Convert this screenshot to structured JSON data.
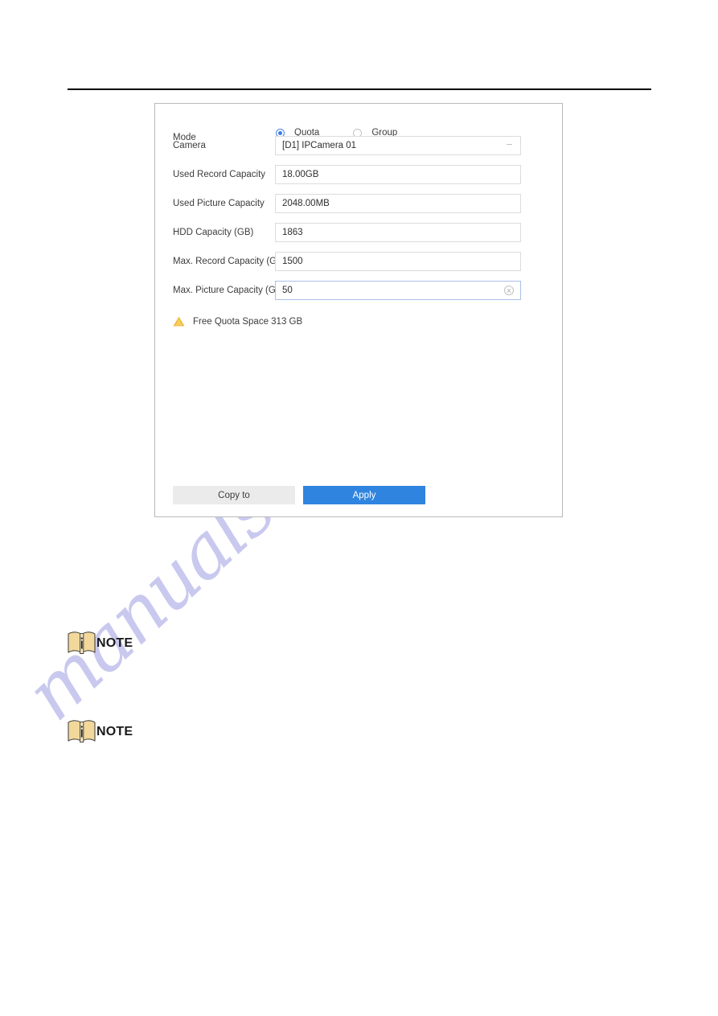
{
  "page": {
    "watermark_text": "manualslive.com",
    "watermark_color": "#c9c9ef",
    "rule_color": "#000000"
  },
  "dialog": {
    "mode": {
      "label": "Mode",
      "options": [
        {
          "label": "Quota",
          "selected": true
        },
        {
          "label": "Group",
          "selected": false
        }
      ]
    },
    "fields": [
      {
        "label": "Camera",
        "value": "[D1] IPCamera 01",
        "control": "dropdown",
        "icon": "chevron-down-icon",
        "focused": false
      },
      {
        "label": "Used Record Capacity",
        "value": "18.00GB",
        "control": "text",
        "focused": false
      },
      {
        "label": "Used Picture Capacity",
        "value": "2048.00MB",
        "control": "text",
        "focused": false
      },
      {
        "label": "HDD Capacity (GB)",
        "value": "1863",
        "control": "text",
        "focused": false
      },
      {
        "label": "Max. Record Capacity (GB)",
        "value": "1500",
        "control": "text",
        "focused": false
      },
      {
        "label": "Max. Picture Capacity (GB)",
        "value": "50",
        "control": "text",
        "icon": "clear-circle-icon",
        "focused": true
      }
    ],
    "quota_note": {
      "icon": "warning-triangle-icon",
      "text": "Free Quota Space 313 GB",
      "icon_color": "#f0b429"
    },
    "buttons": {
      "copy_to": "Copy to",
      "apply": "Apply",
      "apply_color": "#2f84e0",
      "copy_to_color": "#ebebeb"
    }
  },
  "notes": [
    {
      "word": "NOTE",
      "icon": "note-book-icon"
    },
    {
      "word": "NOTE",
      "icon": "note-book-icon"
    }
  ]
}
